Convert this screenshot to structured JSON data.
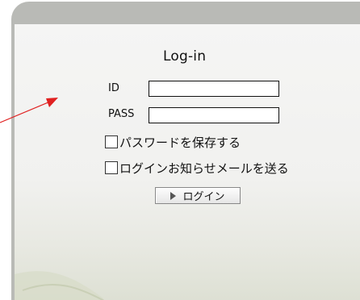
{
  "colors": {
    "panel_frame": "#b9bab6",
    "panel_bg": "#f3f3f1",
    "text": "#111111",
    "arrow": "#e02020"
  },
  "login": {
    "title": "Log-in",
    "id_label": "ID",
    "id_value": "",
    "pass_label": "PASS",
    "pass_value": "",
    "save_password_label": "パスワードを保存する",
    "save_password_checked": false,
    "notify_mail_label": "ログインお知らせメールを送る",
    "notify_mail_checked": false,
    "submit_label": "ログイン",
    "submit_icon": "play-icon"
  },
  "annotation": {
    "arrow_icon": "red-arrow-icon"
  }
}
